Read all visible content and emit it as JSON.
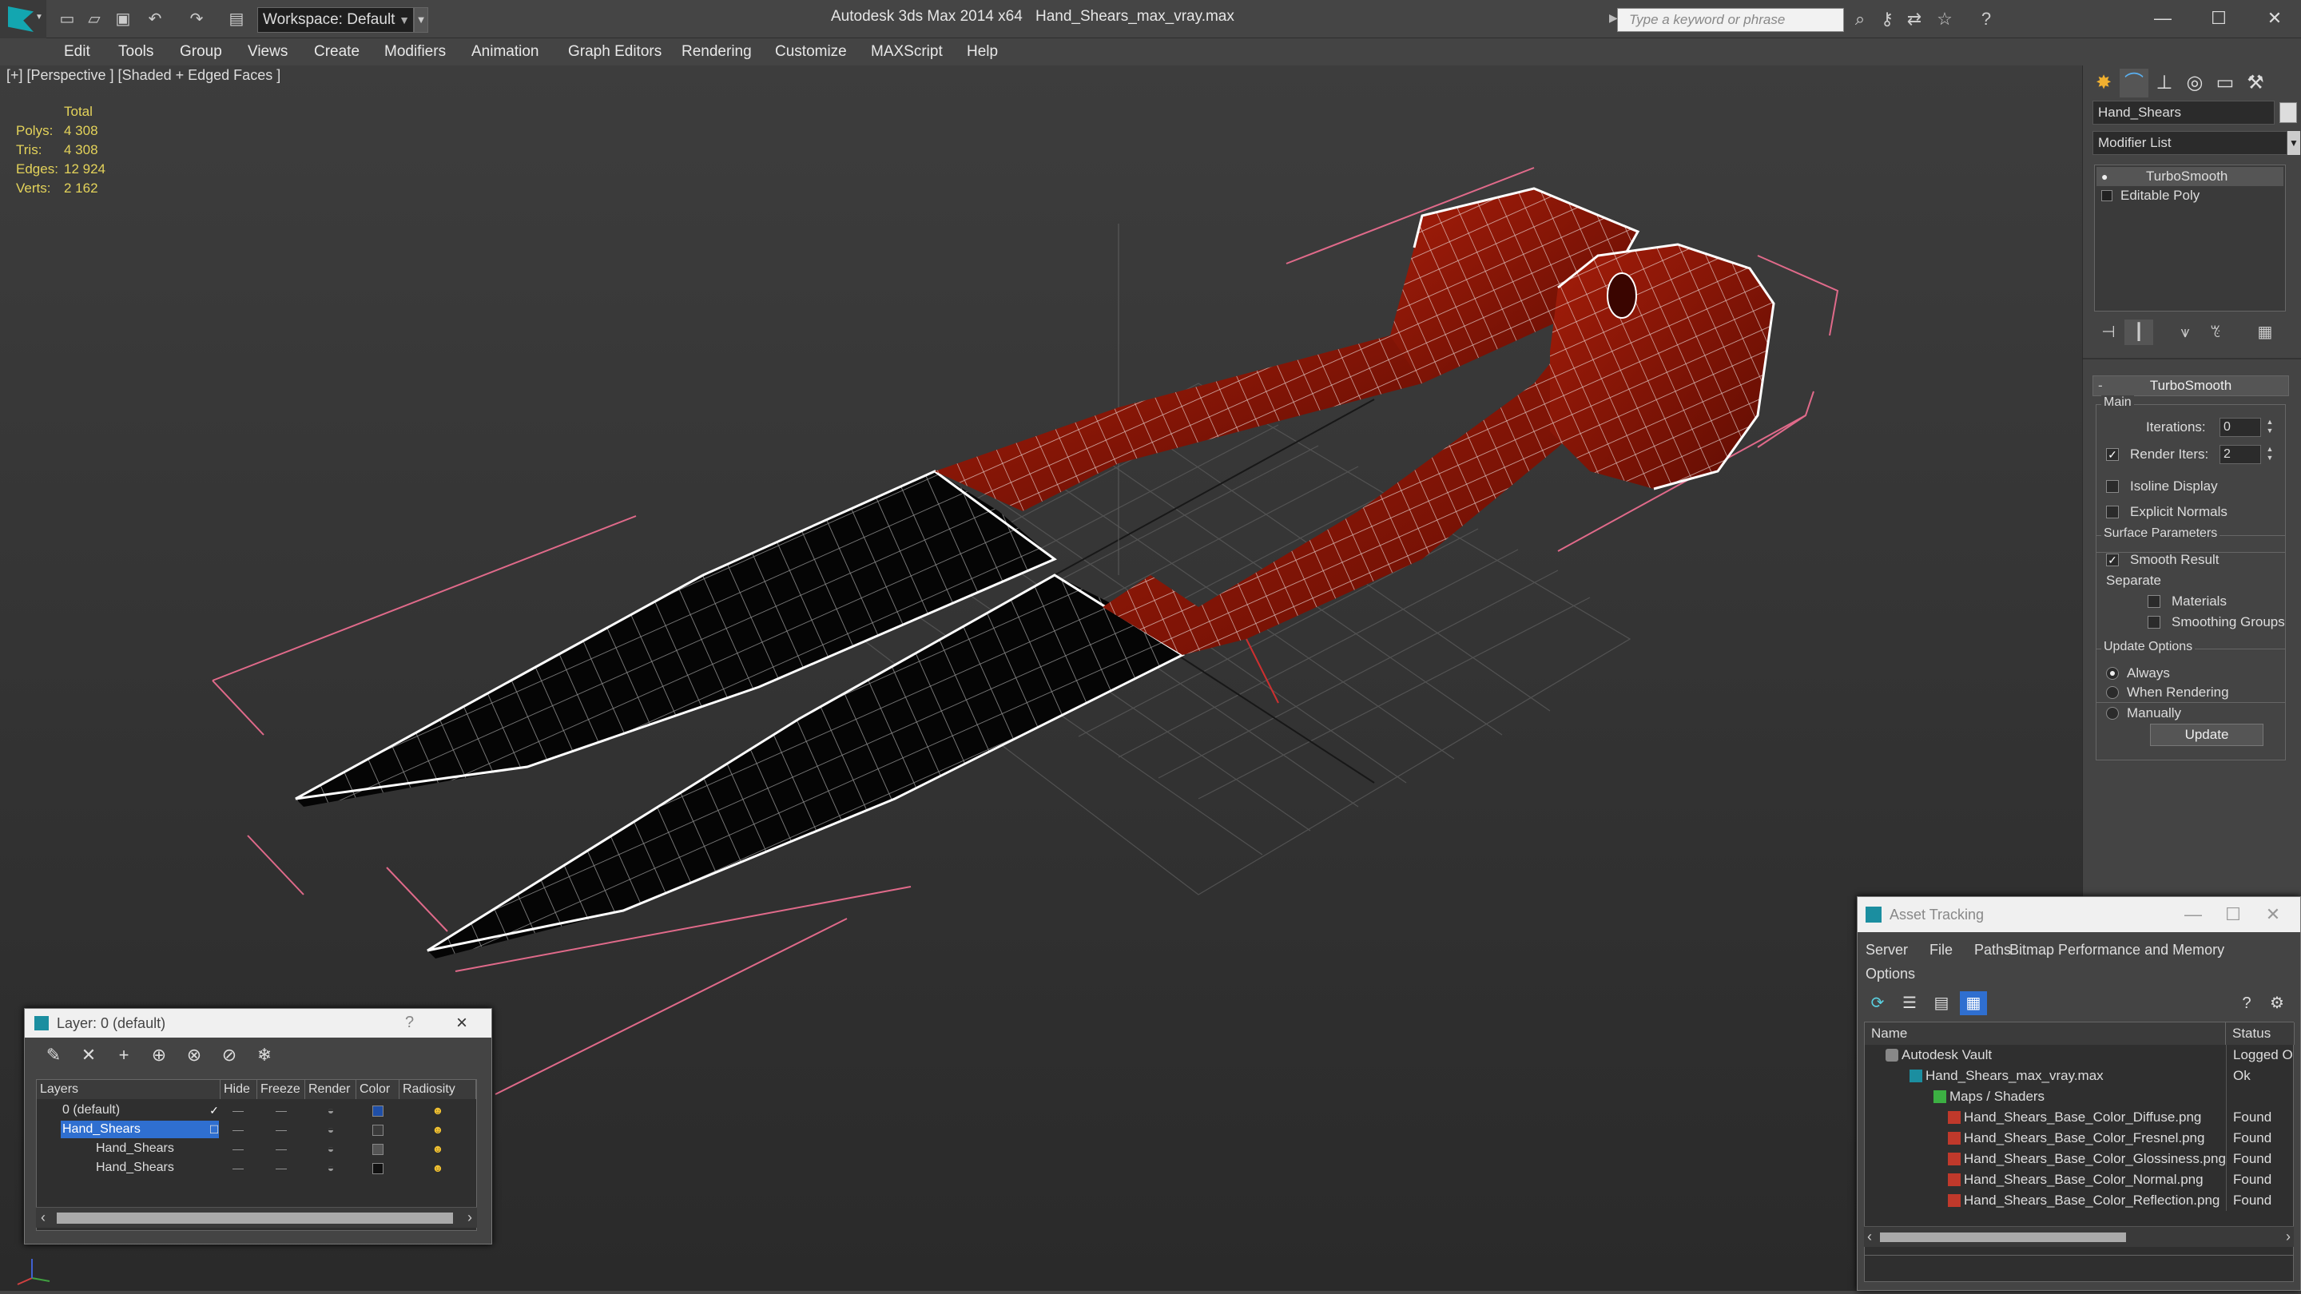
{
  "titlebar": {
    "workspace": "Workspace: Default",
    "app_title": "Autodesk 3ds Max  2014 x64",
    "file_title": "Hand_Shears_max_vray.max",
    "search_placeholder": "Type a keyword or phrase"
  },
  "menu": [
    "Edit",
    "Tools",
    "Group",
    "Views",
    "Create",
    "Modifiers",
    "Animation",
    "Graph Editors",
    "Rendering",
    "Customize",
    "MAXScript",
    "Help"
  ],
  "viewport": {
    "label": "[+] [Perspective ] [Shaded + Edged Faces ]",
    "stats_header": "Total",
    "stats": [
      {
        "label": "Polys:",
        "value": "4 308"
      },
      {
        "label": "Tris:",
        "value": "4 308"
      },
      {
        "label": "Edges:",
        "value": "12 924"
      },
      {
        "label": "Verts:",
        "value": "2 162"
      }
    ]
  },
  "command_panel": {
    "object_name": "Hand_Shears",
    "modifier_list": "Modifier List",
    "stack": [
      "TurboSmooth",
      "Editable Poly"
    ],
    "rollout_title": "TurboSmooth",
    "main_group": "Main",
    "iterations_label": "Iterations:",
    "iterations_value": "0",
    "render_iters_label": "Render Iters:",
    "render_iters_value": "2",
    "isoline_label": "Isoline Display",
    "explicit_normals_label": "Explicit Normals",
    "surface_group": "Surface Parameters",
    "smooth_result_label": "Smooth Result",
    "separate_label": "Separate",
    "materials_label": "Materials",
    "smoothing_groups_label": "Smoothing Groups",
    "update_group": "Update Options",
    "always_label": "Always",
    "when_rendering_label": "When Rendering",
    "manually_label": "Manually",
    "update_button": "Update"
  },
  "layer_dialog": {
    "title": "Layer: 0 (default)",
    "help": "?",
    "columns": [
      "Layers",
      "Hide",
      "Freeze",
      "Render",
      "Color",
      "Radiosity"
    ],
    "rows": [
      {
        "name": "0 (default)",
        "color": "#1f4fa8"
      },
      {
        "name": "Hand_Shears",
        "color": "#3a3a3a"
      },
      {
        "name": "Hand_Shears",
        "color": "#555555"
      },
      {
        "name": "Hand_Shears",
        "color": "#111111"
      }
    ]
  },
  "asset_dialog": {
    "title": "Asset Tracking",
    "menu": [
      "Server",
      "File",
      "Paths",
      "Bitmap Performance and Memory",
      "Options"
    ],
    "columns": [
      "Name",
      "Status"
    ],
    "rows": [
      {
        "name": "Autodesk Vault",
        "status": "Logged O"
      },
      {
        "name": "Hand_Shears_max_vray.max",
        "status": "Ok"
      },
      {
        "name": "Maps / Shaders",
        "status": ""
      },
      {
        "name": "Hand_Shears_Base_Color_Diffuse.png",
        "status": "Found"
      },
      {
        "name": "Hand_Shears_Base_Color_Fresnel.png",
        "status": "Found"
      },
      {
        "name": "Hand_Shears_Base_Color_Glossiness.png",
        "status": "Found"
      },
      {
        "name": "Hand_Shears_Base_Color_Normal.png",
        "status": "Found"
      },
      {
        "name": "Hand_Shears_Base_Color_Reflection.png",
        "status": "Found"
      }
    ]
  },
  "colors": {
    "accent": "#13a6b0",
    "selection": "#2f6fd0",
    "stats_text": "#e4d35a",
    "handle_red": "#8c1606",
    "blade_black": "#050505",
    "bbox_pink": "#e06a8a"
  }
}
